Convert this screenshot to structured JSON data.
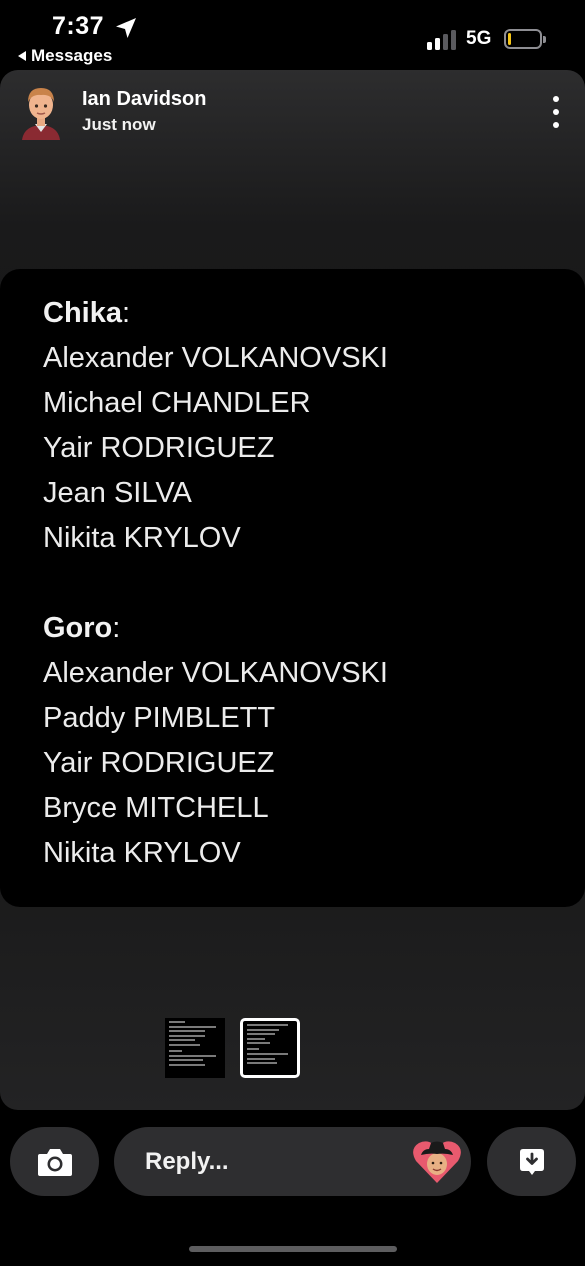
{
  "status_bar": {
    "time": "7:37",
    "back_app": "Messages",
    "network": "5G",
    "signal_bars_active": 2,
    "signal_bars_total": 4,
    "battery_level": 0.08,
    "battery_color": "#f5c518",
    "icons": [
      "location-arrow-icon",
      "signal-icon",
      "battery-icon"
    ]
  },
  "header": {
    "sender_name": "Ian Davidson",
    "timestamp": "Just now",
    "avatar_icon": "bitmoji-avatar-icon",
    "menu_icon": "more-vertical-icon"
  },
  "note": {
    "sections": [
      {
        "heading": "Chika",
        "lines": [
          "Alexander VOLKANOVSKI",
          "Michael CHANDLER",
          "Yair RODRIGUEZ",
          "Jean SILVA",
          "Nikita KRYLOV"
        ]
      },
      {
        "heading": "Goro",
        "lines": [
          "Alexander VOLKANOVSKI",
          "Paddy PIMBLETT",
          "Yair RODRIGUEZ",
          "Bryce MITCHELL",
          "Nikita KRYLOV"
        ]
      }
    ]
  },
  "thumbnails": [
    {
      "active": false
    },
    {
      "active": true
    }
  ],
  "reply_bar": {
    "placeholder": "Reply...",
    "camera_icon": "camera-icon",
    "reaction_icon": "bitmoji-heart-icon",
    "share_icon": "download-bubble-icon"
  },
  "colors": {
    "background": "#000000",
    "card": "#1a1a1b",
    "pill": "#2e2e30",
    "text": "#ffffff"
  }
}
